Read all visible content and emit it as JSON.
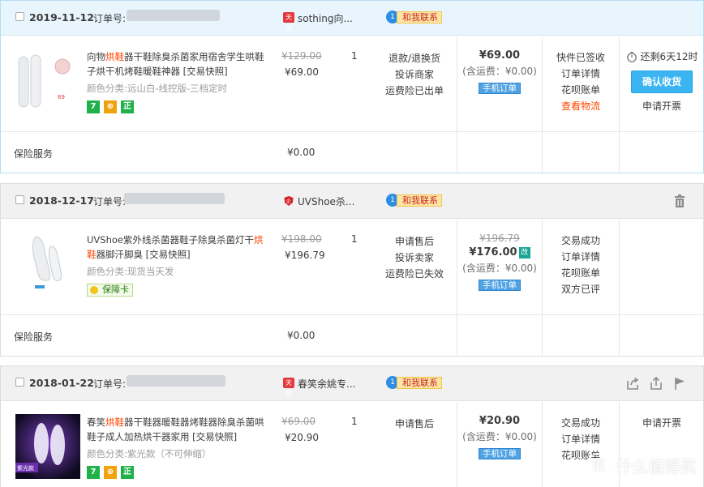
{
  "orders": [
    {
      "date": "2019-11-12",
      "order_no_label": "订单号:",
      "shop_badge": "天猫",
      "shop_name": "sothing向...",
      "contact_label": "和我联系",
      "product": {
        "title_pre": "向物",
        "title_hl": "烘鞋",
        "title_post": "器干鞋除臭杀菌家用宿舍学生哄鞋子烘干机烤鞋暖鞋神器 [交易快照]",
        "sku_label": "颜色分类:",
        "sku_value": "远山白-线控版-三档定时",
        "badges": [
          "7",
          "⊕",
          "正"
        ],
        "thumb_price": "69"
      },
      "orig_price": "¥129.00",
      "price": "¥69.00",
      "qty": "1",
      "services": [
        "退款/退换货",
        "投诉商家",
        "运费险已出单"
      ],
      "pay_amount": "¥69.00",
      "pay_ship": "(含运费：¥0.00)",
      "mobile_order": "手机订单",
      "status": [
        "快件已签收",
        "订单详情",
        "花呗账单"
      ],
      "status_link": "查看物流",
      "timer": "还剩6天12时",
      "confirm_label": "确认收货",
      "invoice_label": "申请开票",
      "insurance_label": "保险服务",
      "insurance_value": "¥0.00"
    },
    {
      "date": "2018-12-17",
      "order_no_label": "订单号:",
      "shop_badge": "企",
      "shop_name": "UVShoe杀...",
      "contact_label": "和我联系",
      "product": {
        "title_pre": "UVShoe紫外线杀菌器鞋子除臭杀菌灯干",
        "title_hl": "烘鞋",
        "title_post": "器脚汗脚臭 [交易快照]",
        "sku_label": "颜色分类:",
        "sku_value": "现货当天发",
        "guard": "保障卡"
      },
      "orig_price": "¥198.00",
      "price": "¥196.79",
      "qty": "1",
      "services": [
        "申请售后",
        "投诉卖家",
        "运费险已失效"
      ],
      "pay_old": "¥196.79",
      "pay_amount": "¥176.00",
      "pay_changed": "改",
      "pay_ship": "(含运费：¥0.00)",
      "mobile_order": "手机订单",
      "status": [
        "交易成功",
        "订单详情",
        "花呗账单",
        "双方已评"
      ],
      "insurance_label": "保险服务",
      "insurance_value": "¥0.00"
    },
    {
      "date": "2018-01-22",
      "order_no_label": "订单号:",
      "shop_badge": "天猫",
      "shop_name": "春笑余姚专...",
      "contact_label": "和我联系",
      "product": {
        "title_pre": "春笑",
        "title_hl": "烘鞋",
        "title_post": "器干鞋器暖鞋器烤鞋器除臭杀菌哄鞋子成人加热烘干器家用 [交易快照]",
        "sku_label": "颜色分类:",
        "sku_value": "紫光款（不可伸缩）",
        "badges": [
          "7",
          "⊕",
          "正"
        ],
        "thumb_tag": "紫光款"
      },
      "orig_price": "¥69.00",
      "price": "¥20.90",
      "qty": "1",
      "services": [
        "申请售后"
      ],
      "pay_amount": "¥20.90",
      "pay_ship": "(含运费：¥0.00)",
      "mobile_order": "手机订单",
      "status": [
        "交易成功",
        "订单详情",
        "花呗账单"
      ],
      "invoice_label": "申请开票"
    }
  ],
  "icons": {
    "delete": "trash-icon",
    "share": "share-icon",
    "upload": "upload-icon",
    "flag": "flag-icon",
    "timer": "timer-icon"
  },
  "watermark": {
    "glyph": "值",
    "text": "什么值得买"
  },
  "colors": {
    "accent_blue": "#3bb4f2",
    "highlight_orange": "#ff4400",
    "tmall_red": "#e4393c",
    "contact_yellow": "#fde6a2"
  }
}
